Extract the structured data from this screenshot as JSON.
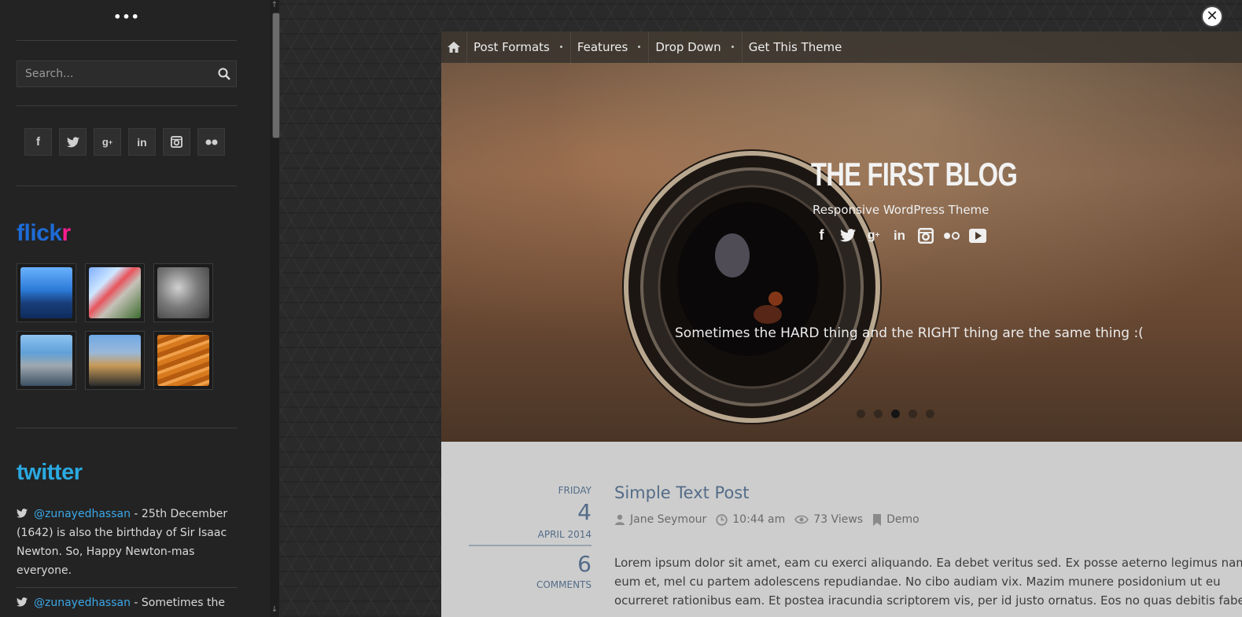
{
  "sidebar": {
    "menu_dots": "•••",
    "search": {
      "placeholder": "Search..."
    },
    "social_icons": [
      "facebook-icon",
      "twitter-icon",
      "google-plus-icon",
      "linkedin-icon",
      "instagram-icon",
      "flickr-icon"
    ],
    "flickr": {
      "logo_part1": "flick",
      "logo_part2": "r",
      "brand_colors": [
        "#1e6bd6",
        "#ff1d8f"
      ]
    },
    "twitter": {
      "logo": "twitter",
      "brand_color": "#2aa9e0",
      "tweets": [
        {
          "handle": "@zunayedhassan",
          "text": " - 25th December (1642) is also the birthday of Sir Isaac Newton. So, Happy Newton-mas everyone."
        },
        {
          "handle": "@zunayedhassan",
          "text": " - Sometimes the"
        }
      ]
    }
  },
  "nav": {
    "items": [
      "Post Formats",
      "Features",
      "Drop Down",
      "Get This Theme"
    ]
  },
  "hero": {
    "title": "THE FIRST BLOG",
    "subtitle": "Responsive WordPress Theme",
    "social_icons": [
      "facebook-icon",
      "twitter-icon",
      "google-plus-icon",
      "linkedin-icon",
      "instagram-icon",
      "flickr-icon",
      "youtube-icon"
    ],
    "quote": "Sometimes the HARD thing and the RIGHT thing are the same thing :(",
    "slides": 5,
    "active_slide": 3
  },
  "post": {
    "weekday": "FRIDAY",
    "day": "4",
    "month_year": "APRIL 2014",
    "comments_count": "6",
    "comments_label": "COMMENTS",
    "title": "Simple Text Post",
    "author": "Jane Seymour",
    "time": "10:44 am",
    "views": "73 Views",
    "category": "Demo",
    "excerpt_lines": [
      "Lorem ipsum dolor sit amet, eam cu exerci aliquando. Ea debet veritus sed. Ex posse aeterno legimus nam",
      "eum et, mel cu partem adolescens repudiandae. No cibo audiam vix. Mazim munere posidonium ut eu",
      "ocurreret rationibus eam. Et postea iracundia scriptorem vis, per id justo ornatus. Eos no quas debitis fabellas."
    ],
    "accent_color": "#536c88"
  }
}
